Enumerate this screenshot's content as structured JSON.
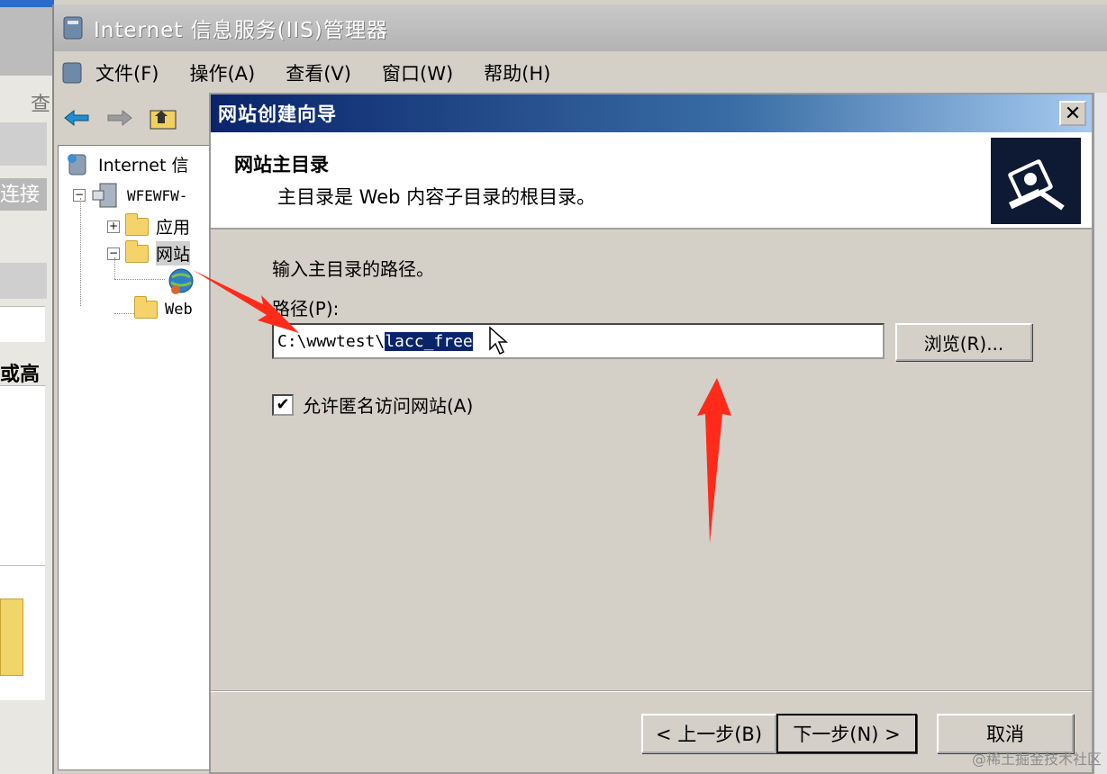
{
  "window": {
    "title": "Internet 信息服务(IIS)管理器"
  },
  "menu": {
    "items": [
      "文件(F)",
      "操作(A)",
      "查看(V)",
      "窗口(W)",
      "帮助(H)"
    ]
  },
  "tree": {
    "root": "Internet 信",
    "server": "WFEWFW-",
    "nodes": [
      "应用",
      "网站",
      "Web"
    ]
  },
  "background": {
    "labels": [
      "查",
      "连接",
      "或高"
    ]
  },
  "dialog": {
    "title": "网站创建向导",
    "header_title": "网站主目录",
    "header_subtitle": "主目录是 Web 内容子目录的根目录。",
    "prompt": "输入主目录的路径。",
    "path_label": "路径(P):",
    "path_prefix": "C:\\wwwtest\\",
    "path_selected": "lacc_free",
    "browse_label": "浏览(R)...",
    "checkbox_label": "允许匿名访问网站(A)",
    "checkbox_checked": true,
    "back_label": "< 上一步(B)",
    "next_label": "下一步(N) >",
    "cancel_label": "取消"
  },
  "watermark": "@稀土掘金技术社区",
  "colors": {
    "dialog_title_start": "#0a246a",
    "annotation_arrow": "#ff2a1a",
    "selection": "#0a246a"
  }
}
